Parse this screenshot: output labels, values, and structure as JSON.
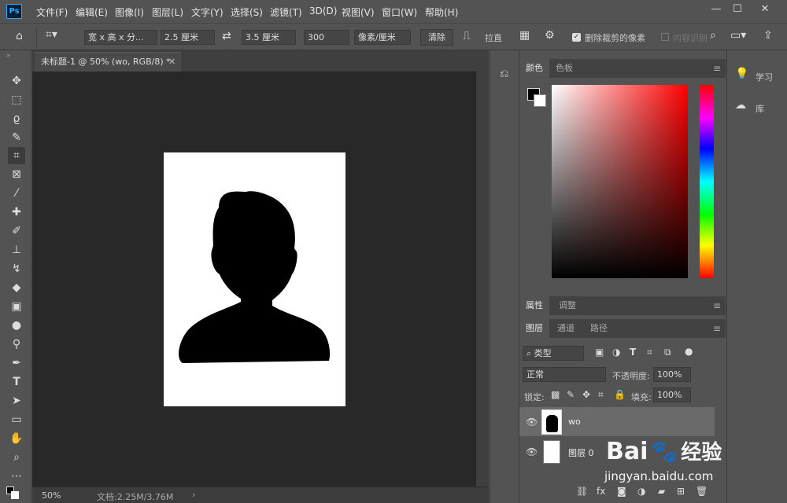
{
  "app": {
    "logo": "Ps"
  },
  "menu": [
    "文件(F)",
    "编辑(E)",
    "图像(I)",
    "图层(L)",
    "文字(Y)",
    "选择(S)",
    "滤镜(T)",
    "3D(D)",
    "视图(V)",
    "窗口(W)",
    "帮助(H)"
  ],
  "window_controls": {
    "minimize": "—",
    "maximize": "☐",
    "close": "✕"
  },
  "options": {
    "ratio_select": "宽 x 高 x 分...",
    "width": "2.5 厘米",
    "height": "3.5 厘米",
    "resolution": "300",
    "unit_select": "像素/厘米",
    "clear_label": "清除",
    "straighten_label": "拉直",
    "delete_cropped_label": "删除裁剪的像素",
    "content_aware_label": "内容识别"
  },
  "document": {
    "tab_title": "未标题-1 @ 50% (wo, RGB/8) *",
    "zoom": "50%",
    "doc_info": "文档:2.25M/3.76M"
  },
  "panels": {
    "color_tabs": [
      "颜色",
      "色板"
    ],
    "properties_tabs": [
      "属性",
      "调整"
    ],
    "layers_tabs": [
      "图层",
      "通道",
      "路径"
    ],
    "filter_kind": "类型",
    "blend_mode": "正常",
    "opacity_label": "不透明度:",
    "opacity_value": "100%",
    "lock_label": "锁定:",
    "fill_label": "填充:",
    "fill_value": "100%",
    "layers": [
      {
        "name": "wo"
      },
      {
        "name": "图层 0"
      }
    ]
  },
  "right_panel": {
    "learn": "学习",
    "library": "库"
  },
  "watermark": {
    "brand": "Bai",
    "brand_cn": "经验",
    "url": "jingyan.baidu.com"
  }
}
